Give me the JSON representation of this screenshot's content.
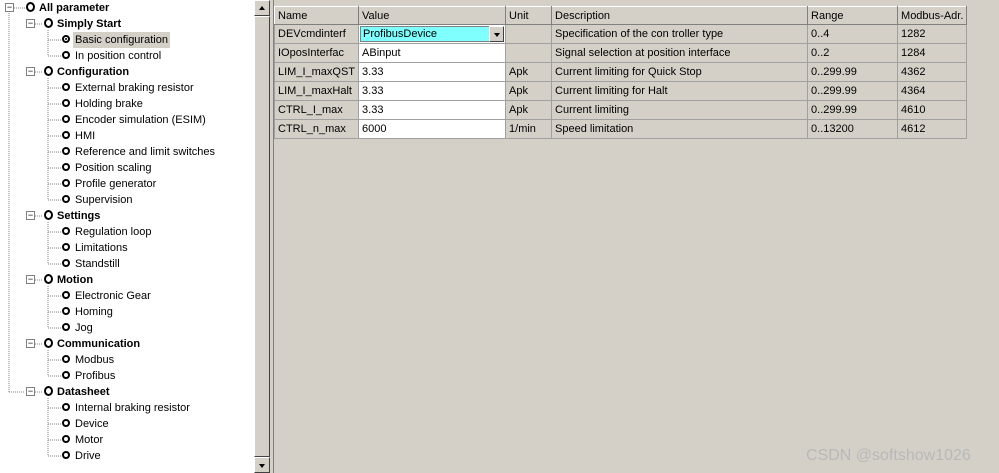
{
  "tree": {
    "root": {
      "label": "All parameter"
    },
    "groups": [
      {
        "label": "Simply Start",
        "items": [
          "Basic configuration",
          "In position control"
        ],
        "selected": "Basic configuration"
      },
      {
        "label": "Configuration",
        "items": [
          "External braking resistor",
          "Holding brake",
          "Encoder simulation (ESIM)",
          "HMI",
          "Reference and limit switches",
          "Position scaling",
          "Profile generator",
          "Supervision"
        ]
      },
      {
        "label": "Settings",
        "items": [
          "Regulation loop",
          "Limitations",
          "Standstill"
        ]
      },
      {
        "label": "Motion",
        "items": [
          "Electronic Gear",
          "Homing",
          "Jog"
        ]
      },
      {
        "label": "Communication",
        "items": [
          "Modbus",
          "Profibus"
        ]
      },
      {
        "label": "Datasheet",
        "items": [
          "Internal braking resistor",
          "Device",
          "Motor",
          "Drive"
        ]
      }
    ],
    "expander_symbol": "−"
  },
  "grid": {
    "columns": [
      "Name",
      "Value",
      "Unit",
      "Description",
      "Range",
      "Modbus-Adr."
    ],
    "rows": [
      {
        "name": "DEVcmdinterf",
        "value": "ProfibusDevice",
        "unit": "",
        "description": "Specification of the con troller type",
        "range": "0..4",
        "modbus": "1282",
        "editor": "dropdown"
      },
      {
        "name": "IOposInterfac",
        "value": "ABinput",
        "unit": "",
        "description": "Signal selection at position interface",
        "range": "0..2",
        "modbus": "1284"
      },
      {
        "name": "LIM_I_maxQST",
        "value": "3.33",
        "unit": "Apk",
        "description": "Current limiting for Quick Stop",
        "range": "0..299.99",
        "modbus": "4362"
      },
      {
        "name": "LIM_I_maxHalt",
        "value": "3.33",
        "unit": "Apk",
        "description": "Current limiting for Halt",
        "range": "0..299.99",
        "modbus": "4364"
      },
      {
        "name": "CTRL_I_max",
        "value": "3.33",
        "unit": "Apk",
        "description": "Current limiting",
        "range": "0..299.99",
        "modbus": "4610"
      },
      {
        "name": "CTRL_n_max",
        "value": "6000",
        "unit": "1/min",
        "description": "Speed limitation",
        "range": "0..13200",
        "modbus": "4612"
      }
    ]
  },
  "colors": {
    "dropdown_highlight": "#80ffff",
    "panel_background": "#d4d0c8"
  },
  "watermark": "CSDN @softshow1026"
}
